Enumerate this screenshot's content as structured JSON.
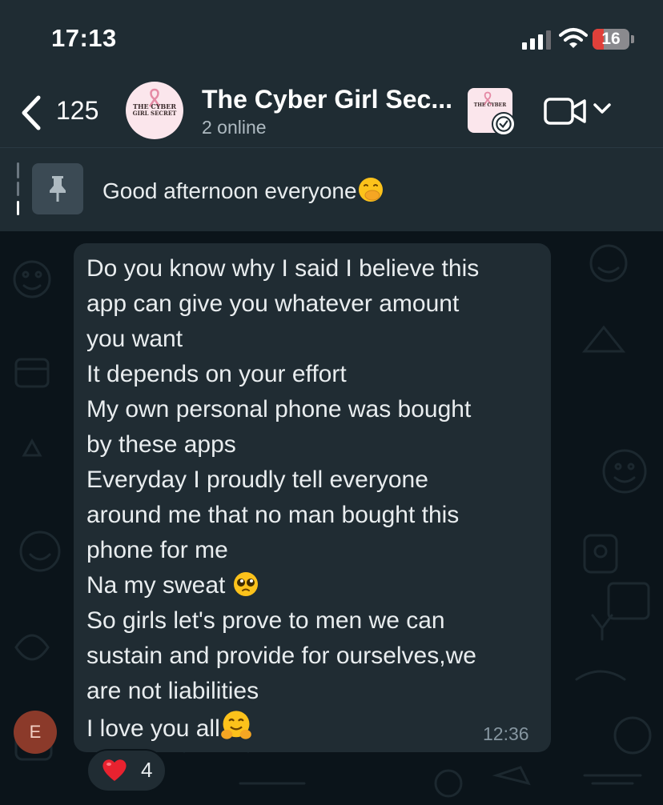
{
  "status_bar": {
    "time": "17:13",
    "battery": "16",
    "battery_color": "#e0403a"
  },
  "header": {
    "back_count": "125",
    "group_title": "The Cyber Girl Sec...",
    "group_subtitle": "2 online",
    "avatar_text_line1": "THE CYBER",
    "avatar_text_line2": "GIRL SECRET",
    "icons": [
      "back-chevron-icon",
      "video-call-icon",
      "chevron-down-icon",
      "verified-badge-icon"
    ]
  },
  "pinned": {
    "text": "Good afternoon everyone",
    "emoji": "face-with-hand-over-mouth",
    "icon": "pin-icon"
  },
  "message": {
    "sender_initial": "E",
    "sender_color": "#8b3a2a",
    "lines": [
      "Do you know why I said I believe this",
      "app can give you whatever amount",
      "you want",
      "It depends on your effort",
      "My own personal phone was bought",
      "by these apps",
      "Everyday I proudly tell everyone",
      "around me that no man bought this",
      "phone for me",
      "Na my sweat ",
      "So girls let's prove to men we can",
      "sustain and provide for ourselves,we",
      "are not liabilities",
      "I love you all"
    ],
    "emojis": {
      "line_9": "pleading-face",
      "line_13": "hugging-face"
    },
    "time": "12:36"
  },
  "reaction": {
    "emoji": "red-heart",
    "count": "4"
  },
  "colors": {
    "header_bg": "#1f2c33",
    "chat_bg": "#0b141a",
    "bubble_bg": "#202c33",
    "secondary_text": "#8696a0"
  }
}
